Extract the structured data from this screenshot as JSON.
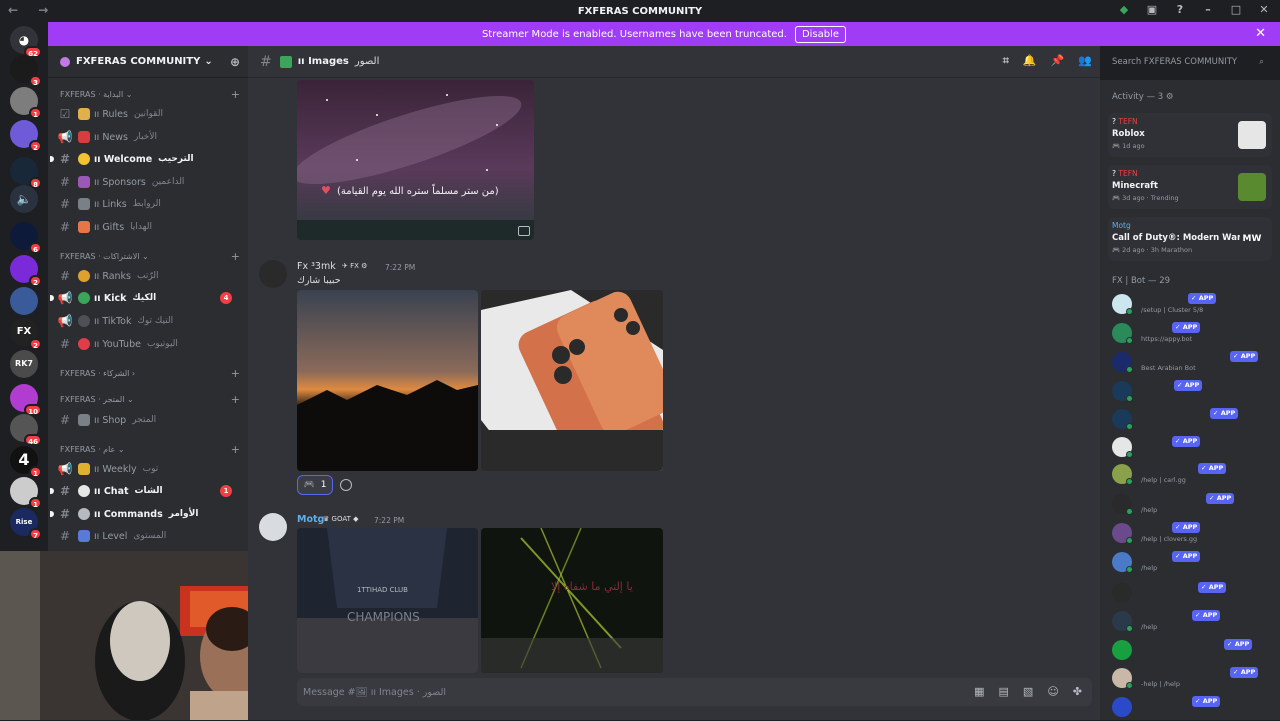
{
  "window": {
    "title": "FXFERAS COMMUNITY"
  },
  "banner": {
    "text": "Streamer Mode is enabled. Usernames have been truncated.",
    "disable_label": "Disable"
  },
  "server_badges": [
    "62",
    "3",
    "1",
    "2",
    "8",
    "6",
    "2",
    "2",
    "10",
    "46",
    "1",
    "1",
    "7"
  ],
  "server_glyphs": {
    "fx": "FX",
    "rk": "RK7",
    "four": "4",
    "rise": "Rise"
  },
  "guild": {
    "name": "FXFERAS COMMUNITY"
  },
  "categories": [
    {
      "label": "FXFERAS · البداية"
    },
    {
      "label": "FXFERAS · الاشتراكات"
    },
    {
      "label": "FXFERAS · الشركاء"
    },
    {
      "label": "FXFERAS · المتجر"
    },
    {
      "label": "FXFERAS · عام"
    }
  ],
  "channels": [
    {
      "name": "Rules",
      "arabic": "القوانين"
    },
    {
      "name": "News",
      "arabic": "الأخبار"
    },
    {
      "name": "Welcome",
      "arabic": "الترحيب"
    },
    {
      "name": "Sponsors",
      "arabic": "الداعمين"
    },
    {
      "name": "Links",
      "arabic": "الروابط"
    },
    {
      "name": "Gifts",
      "arabic": "الهدايا"
    },
    {
      "name": "Ranks",
      "arabic": "الرّتب"
    },
    {
      "name": "Kick",
      "arabic": "الكيك",
      "mention": "4"
    },
    {
      "name": "TikTok",
      "arabic": "التيك توك"
    },
    {
      "name": "YouTube",
      "arabic": "اليوتيوب"
    },
    {
      "name": "Shop",
      "arabic": "المتجر"
    },
    {
      "name": "Weekly",
      "arabic": "توب"
    },
    {
      "name": "Chat",
      "arabic": "الشات",
      "mention": "1"
    },
    {
      "name": "Commands",
      "arabic": "الأوامر"
    },
    {
      "name": "Level",
      "arabic": "المستوى"
    }
  ],
  "channel_header": {
    "name": "Images",
    "arabic": "الصور"
  },
  "messages": [
    {
      "image_caption": "(من ستر مسلماً ستره الله يوم القيامة)"
    },
    {
      "author": "Fx ³3mk",
      "tag": "FX",
      "time": "7:22 PM",
      "text": "حبيبا شارك",
      "reaction_count": "1"
    },
    {
      "author": "Motg",
      "tag": "GOAT",
      "time": "7:22 PM",
      "image_text_1": "1TTIHAD CLUB",
      "image_text_2": "CHAMPIONS",
      "image_text_3": "يا إلتي ما شفاه إلا"
    }
  ],
  "composer": {
    "placeholder": "Message #🖼 ıı Images · الصور"
  },
  "search": {
    "placeholder": "Search FXFERAS COMMUNITY"
  },
  "activity": {
    "title": "Activity — 3",
    "items": [
      {
        "user": "TEFN",
        "game": "Roblox",
        "meta": "1d ago"
      },
      {
        "user": "TEFN",
        "game": "Minecraft",
        "meta": "3d ago",
        "meta2": "Trending"
      },
      {
        "user": "Motg",
        "game": "Call of Duty®: Modern Warf...",
        "meta": "2d ago",
        "meta2": "3h Marathon",
        "thumb_text": "MW"
      }
    ]
  },
  "bots": {
    "title": "FX | Bot — 29",
    "app_label": "✓ APP",
    "items": [
      {
        "sub": "/setup | Cluster 5/8"
      },
      {
        "sub": "https://appy.bot"
      },
      {
        "sub": "Best Arabian Bot"
      },
      {
        "sub": ""
      },
      {
        "sub": ""
      },
      {
        "sub": ""
      },
      {
        "sub": "/help | carl.gg"
      },
      {
        "sub": "/help"
      },
      {
        "sub": "/help | clovers.gg"
      },
      {
        "sub": "/help"
      },
      {
        "sub": ""
      },
      {
        "sub": "/help"
      },
      {
        "sub": ""
      },
      {
        "sub": "-help | /help"
      },
      {
        "sub": ""
      }
    ]
  }
}
